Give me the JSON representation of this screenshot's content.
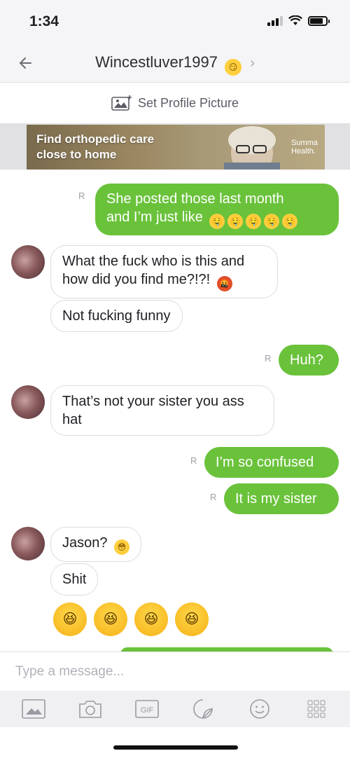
{
  "status": {
    "time": "1:34"
  },
  "header": {
    "title": "Wincestluver1997",
    "title_emoji": "😏"
  },
  "profile": {
    "label": "Set Profile Picture"
  },
  "ad": {
    "line1": "Find orthopedic care",
    "line2": "close to home",
    "brand1": "Summa",
    "brand2": "Health."
  },
  "messages": [
    {
      "dir": "out",
      "read": "R",
      "line1": "She posted those last month",
      "line2": "and I’m just like",
      "emojis": [
        "🤤",
        "🤤",
        "🤤",
        "🤤",
        "🤤"
      ]
    },
    {
      "dir": "in",
      "line1": "What the fuck who is this and",
      "line2": "how did you find me?!?!",
      "emoji": "🤬"
    },
    {
      "dir": "in",
      "text": "Not fucking funny"
    },
    {
      "dir": "out",
      "read": "R",
      "text": "Huh?"
    },
    {
      "dir": "in",
      "line1": "That’s not your sister you ass",
      "line2": "hat"
    },
    {
      "dir": "out",
      "read": "R",
      "text": "I’m so confused"
    },
    {
      "dir": "out",
      "read": "R",
      "text": "It is my sister"
    },
    {
      "dir": "in",
      "text": "Jason?",
      "emoji": "😳"
    },
    {
      "dir": "in",
      "text": "Shit"
    },
    {
      "dir": "in",
      "emojis": [
        "😆",
        "😆",
        "😆",
        "😆"
      ]
    }
  ],
  "composer": {
    "placeholder": "Type a message..."
  },
  "toolbar": {
    "gif_label": "GIF"
  },
  "colors": {
    "outgoing": "#6ac23b",
    "incoming_border": "#dcdce0",
    "toolbar_bg": "#f0f0f2"
  }
}
